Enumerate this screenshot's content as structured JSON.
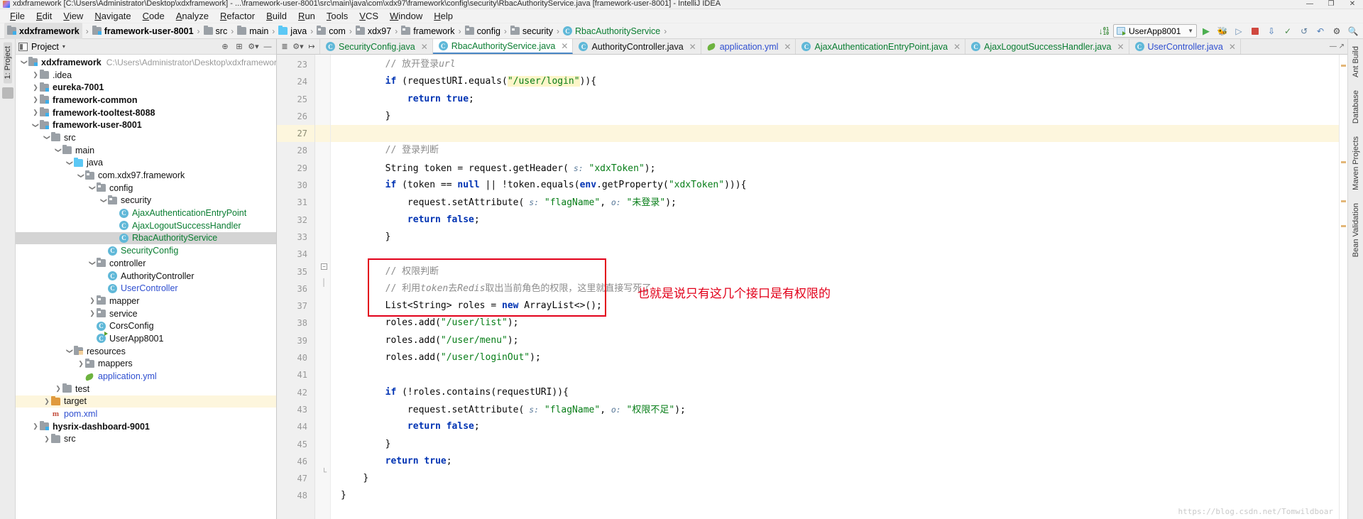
{
  "window": {
    "title": "xdxframework [C:\\Users\\Administrator\\Desktop\\xdxframework] - ...\\framework-user-8001\\src\\main\\java\\com\\xdx97\\framework\\config\\security\\RbacAuthorityService.java [framework-user-8001] - IntelliJ IDEA",
    "minimize": "—",
    "maximize": "❐",
    "close": "✕"
  },
  "menu": {
    "items": [
      {
        "label": "File"
      },
      {
        "label": "Edit"
      },
      {
        "label": "View"
      },
      {
        "label": "Navigate"
      },
      {
        "label": "Code"
      },
      {
        "label": "Analyze"
      },
      {
        "label": "Refactor"
      },
      {
        "label": "Build"
      },
      {
        "label": "Run"
      },
      {
        "label": "Tools"
      },
      {
        "label": "VCS"
      },
      {
        "label": "Window"
      },
      {
        "label": "Help"
      }
    ]
  },
  "breadcrumb": {
    "items": [
      {
        "label": "xdxframework",
        "icon": "module-folder-icon",
        "bold": true,
        "kind": "module"
      },
      {
        "label": "framework-user-8001",
        "icon": "module-folder-icon",
        "bold": true,
        "kind": "module"
      },
      {
        "label": "src",
        "icon": "folder-icon",
        "kind": "folder"
      },
      {
        "label": "main",
        "icon": "folder-icon",
        "kind": "folder"
      },
      {
        "label": "java",
        "icon": "source-folder-icon",
        "kind": "java-src"
      },
      {
        "label": "com",
        "icon": "package-icon",
        "kind": "pkg"
      },
      {
        "label": "xdx97",
        "icon": "package-icon",
        "kind": "pkg"
      },
      {
        "label": "framework",
        "icon": "package-icon",
        "kind": "pkg"
      },
      {
        "label": "config",
        "icon": "package-icon",
        "kind": "pkg"
      },
      {
        "label": "security",
        "icon": "package-icon",
        "kind": "pkg"
      },
      {
        "label": "RbacAuthorityService",
        "icon": "class-icon",
        "kind": "class"
      }
    ]
  },
  "toolbar": {
    "download_sources_icon": "download-binary-icon",
    "run_config": "UserApp8001",
    "run_icon": "run-icon",
    "debug_icon": "debug-icon",
    "coverage_icon": "coverage-icon",
    "stop_icon": "stop-icon",
    "update_icon": "update-project-icon",
    "commit_icon": "commit-icon",
    "revert_icon": "revert-icon",
    "undo_icon": "undo-icon",
    "settings_icon": "settings-icon",
    "search_icon": "search-icon"
  },
  "project_panel": {
    "title": "Project",
    "caret": "▾",
    "actions": [
      "collapse-all-icon",
      "locate-icon",
      "settings-icon",
      "minimize-icon"
    ],
    "tree": [
      {
        "depth": 0,
        "arrow": "down",
        "icon": "module-folder-icon",
        "label": "xdxframework",
        "bold": true,
        "path": "C:\\Users\\Administrator\\Desktop\\xdxframework",
        "color": "dark"
      },
      {
        "depth": 1,
        "arrow": "right",
        "icon": "folder-icon",
        "label": ".idea",
        "color": "dark"
      },
      {
        "depth": 1,
        "arrow": "right",
        "icon": "module-folder-icon",
        "label": "eureka-7001",
        "bold": true,
        "color": "dark"
      },
      {
        "depth": 1,
        "arrow": "right",
        "icon": "module-folder-icon",
        "label": "framework-common",
        "bold": true,
        "color": "dark"
      },
      {
        "depth": 1,
        "arrow": "right",
        "icon": "module-folder-icon",
        "label": "framework-tooltest-8088",
        "bold": true,
        "color": "dark"
      },
      {
        "depth": 1,
        "arrow": "down",
        "icon": "module-folder-icon",
        "label": "framework-user-8001",
        "bold": true,
        "color": "dark"
      },
      {
        "depth": 2,
        "arrow": "down",
        "icon": "folder-icon",
        "label": "src",
        "color": "dark"
      },
      {
        "depth": 3,
        "arrow": "down",
        "icon": "folder-icon",
        "label": "main",
        "color": "dark"
      },
      {
        "depth": 4,
        "arrow": "down",
        "icon": "source-folder-icon",
        "label": "java",
        "color": "dark"
      },
      {
        "depth": 5,
        "arrow": "down",
        "icon": "package-icon",
        "label": "com.xdx97.framework",
        "color": "dark"
      },
      {
        "depth": 6,
        "arrow": "down",
        "icon": "package-icon",
        "label": "config",
        "color": "dark"
      },
      {
        "depth": 7,
        "arrow": "down",
        "icon": "package-icon",
        "label": "security",
        "color": "dark"
      },
      {
        "depth": 8,
        "arrow": "none",
        "icon": "class-icon",
        "label": "AjaxAuthenticationEntryPoint",
        "color": "green"
      },
      {
        "depth": 8,
        "arrow": "none",
        "icon": "class-icon",
        "label": "AjaxLogoutSuccessHandler",
        "color": "green"
      },
      {
        "depth": 8,
        "arrow": "none",
        "icon": "class-icon",
        "label": "RbacAuthorityService",
        "color": "green",
        "selected": true
      },
      {
        "depth": 7,
        "arrow": "none",
        "icon": "class-icon",
        "label": "SecurityConfig",
        "color": "green"
      },
      {
        "depth": 6,
        "arrow": "down",
        "icon": "package-icon",
        "label": "controller",
        "color": "dark"
      },
      {
        "depth": 7,
        "arrow": "none",
        "icon": "class-icon",
        "label": "AuthorityController",
        "color": "dark"
      },
      {
        "depth": 7,
        "arrow": "none",
        "icon": "class-icon",
        "label": "UserController",
        "color": "blue"
      },
      {
        "depth": 6,
        "arrow": "right",
        "icon": "package-icon",
        "label": "mapper",
        "color": "dark"
      },
      {
        "depth": 6,
        "arrow": "right",
        "icon": "package-icon",
        "label": "service",
        "color": "dark"
      },
      {
        "depth": 6,
        "arrow": "none",
        "icon": "class-icon",
        "label": "CorsConfig",
        "color": "dark"
      },
      {
        "depth": 6,
        "arrow": "none",
        "icon": "runnable-class-icon",
        "label": "UserApp8001",
        "color": "dark"
      },
      {
        "depth": 4,
        "arrow": "down",
        "icon": "resources-folder-icon",
        "label": "resources",
        "color": "dark"
      },
      {
        "depth": 5,
        "arrow": "right",
        "icon": "package-icon",
        "label": "mappers",
        "color": "dark"
      },
      {
        "depth": 5,
        "arrow": "none",
        "icon": "yaml-icon",
        "label": "application.yml",
        "color": "blue"
      },
      {
        "depth": 3,
        "arrow": "right",
        "icon": "folder-icon",
        "label": "test",
        "color": "dark"
      },
      {
        "depth": 2,
        "arrow": "right",
        "icon": "target-folder-icon",
        "label": "target",
        "color": "dark",
        "highlight": true
      },
      {
        "depth": 2,
        "arrow": "none",
        "icon": "maven-icon",
        "label": "pom.xml",
        "color": "blue"
      },
      {
        "depth": 1,
        "arrow": "right",
        "icon": "module-folder-icon",
        "label": "hysrix-dashboard-9001",
        "bold": true,
        "color": "dark"
      },
      {
        "depth": 2,
        "arrow": "right",
        "icon": "folder-icon",
        "label": "src",
        "color": "dark"
      }
    ]
  },
  "editor": {
    "tools": [
      "expand-collapse-icon",
      "settings-icon",
      "select-opened-file-icon"
    ],
    "tabs": [
      {
        "label": "SecurityConfig.java",
        "icon": "class-icon",
        "color": "green",
        "active": false
      },
      {
        "label": "RbacAuthorityService.java",
        "icon": "class-icon",
        "color": "green",
        "active": true
      },
      {
        "label": "AuthorityController.java",
        "icon": "class-icon",
        "color": "dark",
        "active": false
      },
      {
        "label": "application.yml",
        "icon": "yaml-icon",
        "color": "blue",
        "active": false
      },
      {
        "label": "AjaxAuthenticationEntryPoint.java",
        "icon": "class-icon",
        "color": "green",
        "active": false
      },
      {
        "label": "AjaxLogoutSuccessHandler.java",
        "icon": "class-icon",
        "color": "green",
        "active": false
      },
      {
        "label": "UserController.java",
        "icon": "class-icon",
        "color": "blue",
        "active": false
      }
    ],
    "close_glyph": "✕",
    "current_line": 27,
    "lines": [
      {
        "num": 23,
        "indent": 8,
        "tokens": [
          {
            "t": "// 放开登录",
            "c": "cmt"
          },
          {
            "t": "url",
            "c": "cmt-i"
          }
        ]
      },
      {
        "num": 24,
        "indent": 8,
        "tokens": [
          {
            "t": "if",
            "c": "kw"
          },
          {
            "t": " (requestURI.equals(",
            "c": "plain"
          },
          {
            "t": "\"/user/login\"",
            "c": "str-hl"
          },
          {
            "t": ")){",
            "c": "plain"
          }
        ]
      },
      {
        "num": 25,
        "indent": 12,
        "tokens": [
          {
            "t": "return",
            "c": "kw"
          },
          {
            "t": " ",
            "c": "plain"
          },
          {
            "t": "true",
            "c": "kw"
          },
          {
            "t": ";",
            "c": "plain"
          }
        ]
      },
      {
        "num": 26,
        "indent": 8,
        "tokens": [
          {
            "t": "}",
            "c": "plain"
          }
        ]
      },
      {
        "num": 27,
        "indent": 0,
        "tokens": []
      },
      {
        "num": 28,
        "indent": 8,
        "tokens": [
          {
            "t": "// 登录判断",
            "c": "cmt"
          }
        ]
      },
      {
        "num": 29,
        "indent": 8,
        "tokens": [
          {
            "t": "String token = request.getHeader(",
            "c": "plain"
          },
          {
            "t": " s:",
            "c": "param"
          },
          {
            "t": " ",
            "c": "plain"
          },
          {
            "t": "\"xdxToken\"",
            "c": "str"
          },
          {
            "t": ");",
            "c": "plain"
          }
        ]
      },
      {
        "num": 30,
        "indent": 8,
        "tokens": [
          {
            "t": "if",
            "c": "kw"
          },
          {
            "t": " (token == ",
            "c": "plain"
          },
          {
            "t": "null",
            "c": "kw"
          },
          {
            "t": " || !token.equals(",
            "c": "plain"
          },
          {
            "t": "env",
            "c": "kw"
          },
          {
            "t": ".getProperty(",
            "c": "plain"
          },
          {
            "t": "\"xdxToken\"",
            "c": "str"
          },
          {
            "t": "))){",
            "c": "plain"
          }
        ]
      },
      {
        "num": 31,
        "indent": 12,
        "tokens": [
          {
            "t": "request.setAttribute(",
            "c": "plain"
          },
          {
            "t": " s:",
            "c": "param"
          },
          {
            "t": " ",
            "c": "plain"
          },
          {
            "t": "\"flagName\"",
            "c": "str"
          },
          {
            "t": ", ",
            "c": "plain"
          },
          {
            "t": "o:",
            "c": "param"
          },
          {
            "t": " ",
            "c": "plain"
          },
          {
            "t": "\"未登录\"",
            "c": "str"
          },
          {
            "t": ");",
            "c": "plain"
          }
        ]
      },
      {
        "num": 32,
        "indent": 12,
        "tokens": [
          {
            "t": "return",
            "c": "kw"
          },
          {
            "t": " ",
            "c": "plain"
          },
          {
            "t": "false",
            "c": "kw"
          },
          {
            "t": ";",
            "c": "plain"
          }
        ]
      },
      {
        "num": 33,
        "indent": 8,
        "tokens": [
          {
            "t": "}",
            "c": "plain"
          }
        ]
      },
      {
        "num": 34,
        "indent": 0,
        "tokens": []
      },
      {
        "num": 35,
        "indent": 8,
        "tokens": [
          {
            "t": "// 权限判断",
            "c": "cmt"
          }
        ]
      },
      {
        "num": 36,
        "indent": 8,
        "tokens": [
          {
            "t": "// 利用",
            "c": "cmt"
          },
          {
            "t": "token",
            "c": "cmt-i"
          },
          {
            "t": "去",
            "c": "cmt"
          },
          {
            "t": "Redis",
            "c": "cmt-i"
          },
          {
            "t": "取出当前角色的权限，这里就直接写死了",
            "c": "cmt"
          }
        ]
      },
      {
        "num": 37,
        "indent": 8,
        "tokens": [
          {
            "t": "List<String> roles = ",
            "c": "plain"
          },
          {
            "t": "new",
            "c": "kw"
          },
          {
            "t": " ArrayList<>();",
            "c": "plain"
          }
        ]
      },
      {
        "num": 38,
        "indent": 8,
        "tokens": [
          {
            "t": "roles.add(",
            "c": "plain"
          },
          {
            "t": "\"/user/list\"",
            "c": "str"
          },
          {
            "t": ");",
            "c": "plain"
          }
        ]
      },
      {
        "num": 39,
        "indent": 8,
        "tokens": [
          {
            "t": "roles.add(",
            "c": "plain"
          },
          {
            "t": "\"/user/menu\"",
            "c": "str"
          },
          {
            "t": ");",
            "c": "plain"
          }
        ]
      },
      {
        "num": 40,
        "indent": 8,
        "tokens": [
          {
            "t": "roles.add(",
            "c": "plain"
          },
          {
            "t": "\"/user/loginOut\"",
            "c": "str"
          },
          {
            "t": ");",
            "c": "plain"
          }
        ]
      },
      {
        "num": 41,
        "indent": 0,
        "tokens": []
      },
      {
        "num": 42,
        "indent": 8,
        "tokens": [
          {
            "t": "if",
            "c": "kw"
          },
          {
            "t": " (!roles.contains(requestURI)){",
            "c": "plain"
          }
        ]
      },
      {
        "num": 43,
        "indent": 12,
        "tokens": [
          {
            "t": "request.setAttribute(",
            "c": "plain"
          },
          {
            "t": " s:",
            "c": "param"
          },
          {
            "t": " ",
            "c": "plain"
          },
          {
            "t": "\"flagName\"",
            "c": "str"
          },
          {
            "t": ", ",
            "c": "plain"
          },
          {
            "t": "o:",
            "c": "param"
          },
          {
            "t": " ",
            "c": "plain"
          },
          {
            "t": "\"权限不足\"",
            "c": "str"
          },
          {
            "t": ");",
            "c": "plain"
          }
        ]
      },
      {
        "num": 44,
        "indent": 12,
        "tokens": [
          {
            "t": "return",
            "c": "kw"
          },
          {
            "t": " ",
            "c": "plain"
          },
          {
            "t": "false",
            "c": "kw"
          },
          {
            "t": ";",
            "c": "plain"
          }
        ]
      },
      {
        "num": 45,
        "indent": 8,
        "tokens": [
          {
            "t": "}",
            "c": "plain"
          }
        ]
      },
      {
        "num": 46,
        "indent": 8,
        "tokens": [
          {
            "t": "return",
            "c": "kw"
          },
          {
            "t": " ",
            "c": "plain"
          },
          {
            "t": "true",
            "c": "kw"
          },
          {
            "t": ";",
            "c": "plain"
          }
        ]
      },
      {
        "num": 47,
        "indent": 4,
        "tokens": [
          {
            "t": "}",
            "c": "plain"
          }
        ]
      },
      {
        "num": 48,
        "indent": 0,
        "tokens": [
          {
            "t": "}",
            "c": "plain"
          }
        ]
      }
    ]
  },
  "annotation": {
    "box_color": "#e2001a",
    "text": "也就是说只有这几个接口是有权限的",
    "text_color": "#e2001a"
  },
  "right_rail": {
    "items": [
      "Ant Build",
      "Database",
      "Maven Projects",
      "Bean Validation"
    ]
  },
  "left_rail": {
    "label": "1: Project"
  },
  "watermark": "https://blog.csdn.net/Tomwildboar"
}
